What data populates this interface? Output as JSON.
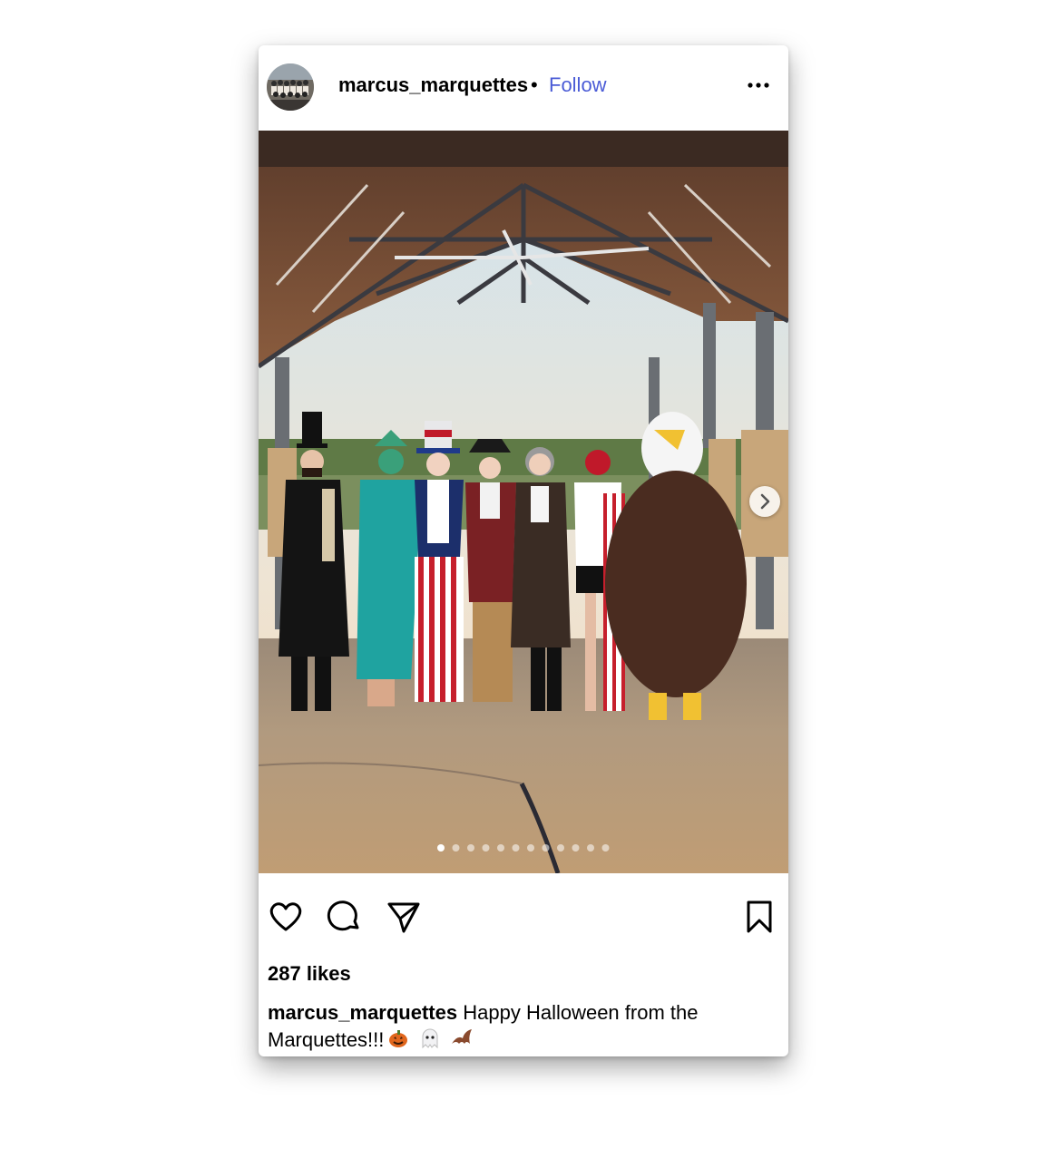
{
  "post": {
    "username": "marcus_marquettes",
    "separator": "•",
    "follow_label": "Follow",
    "likes": "287 likes",
    "caption_user": "marcus_marquettes",
    "caption_text": "Happy Halloween from the Marquettes!!!",
    "carousel": {
      "slide_count": 12,
      "active_index": 0
    }
  },
  "icons": {
    "more": "more-options-icon",
    "like": "heart-icon",
    "comment": "comment-bubble-icon",
    "share": "paper-plane-icon",
    "save": "bookmark-icon",
    "next": "chevron-right-icon"
  },
  "colors": {
    "follow_blue": "#4a5bd6",
    "text": "#000000"
  }
}
